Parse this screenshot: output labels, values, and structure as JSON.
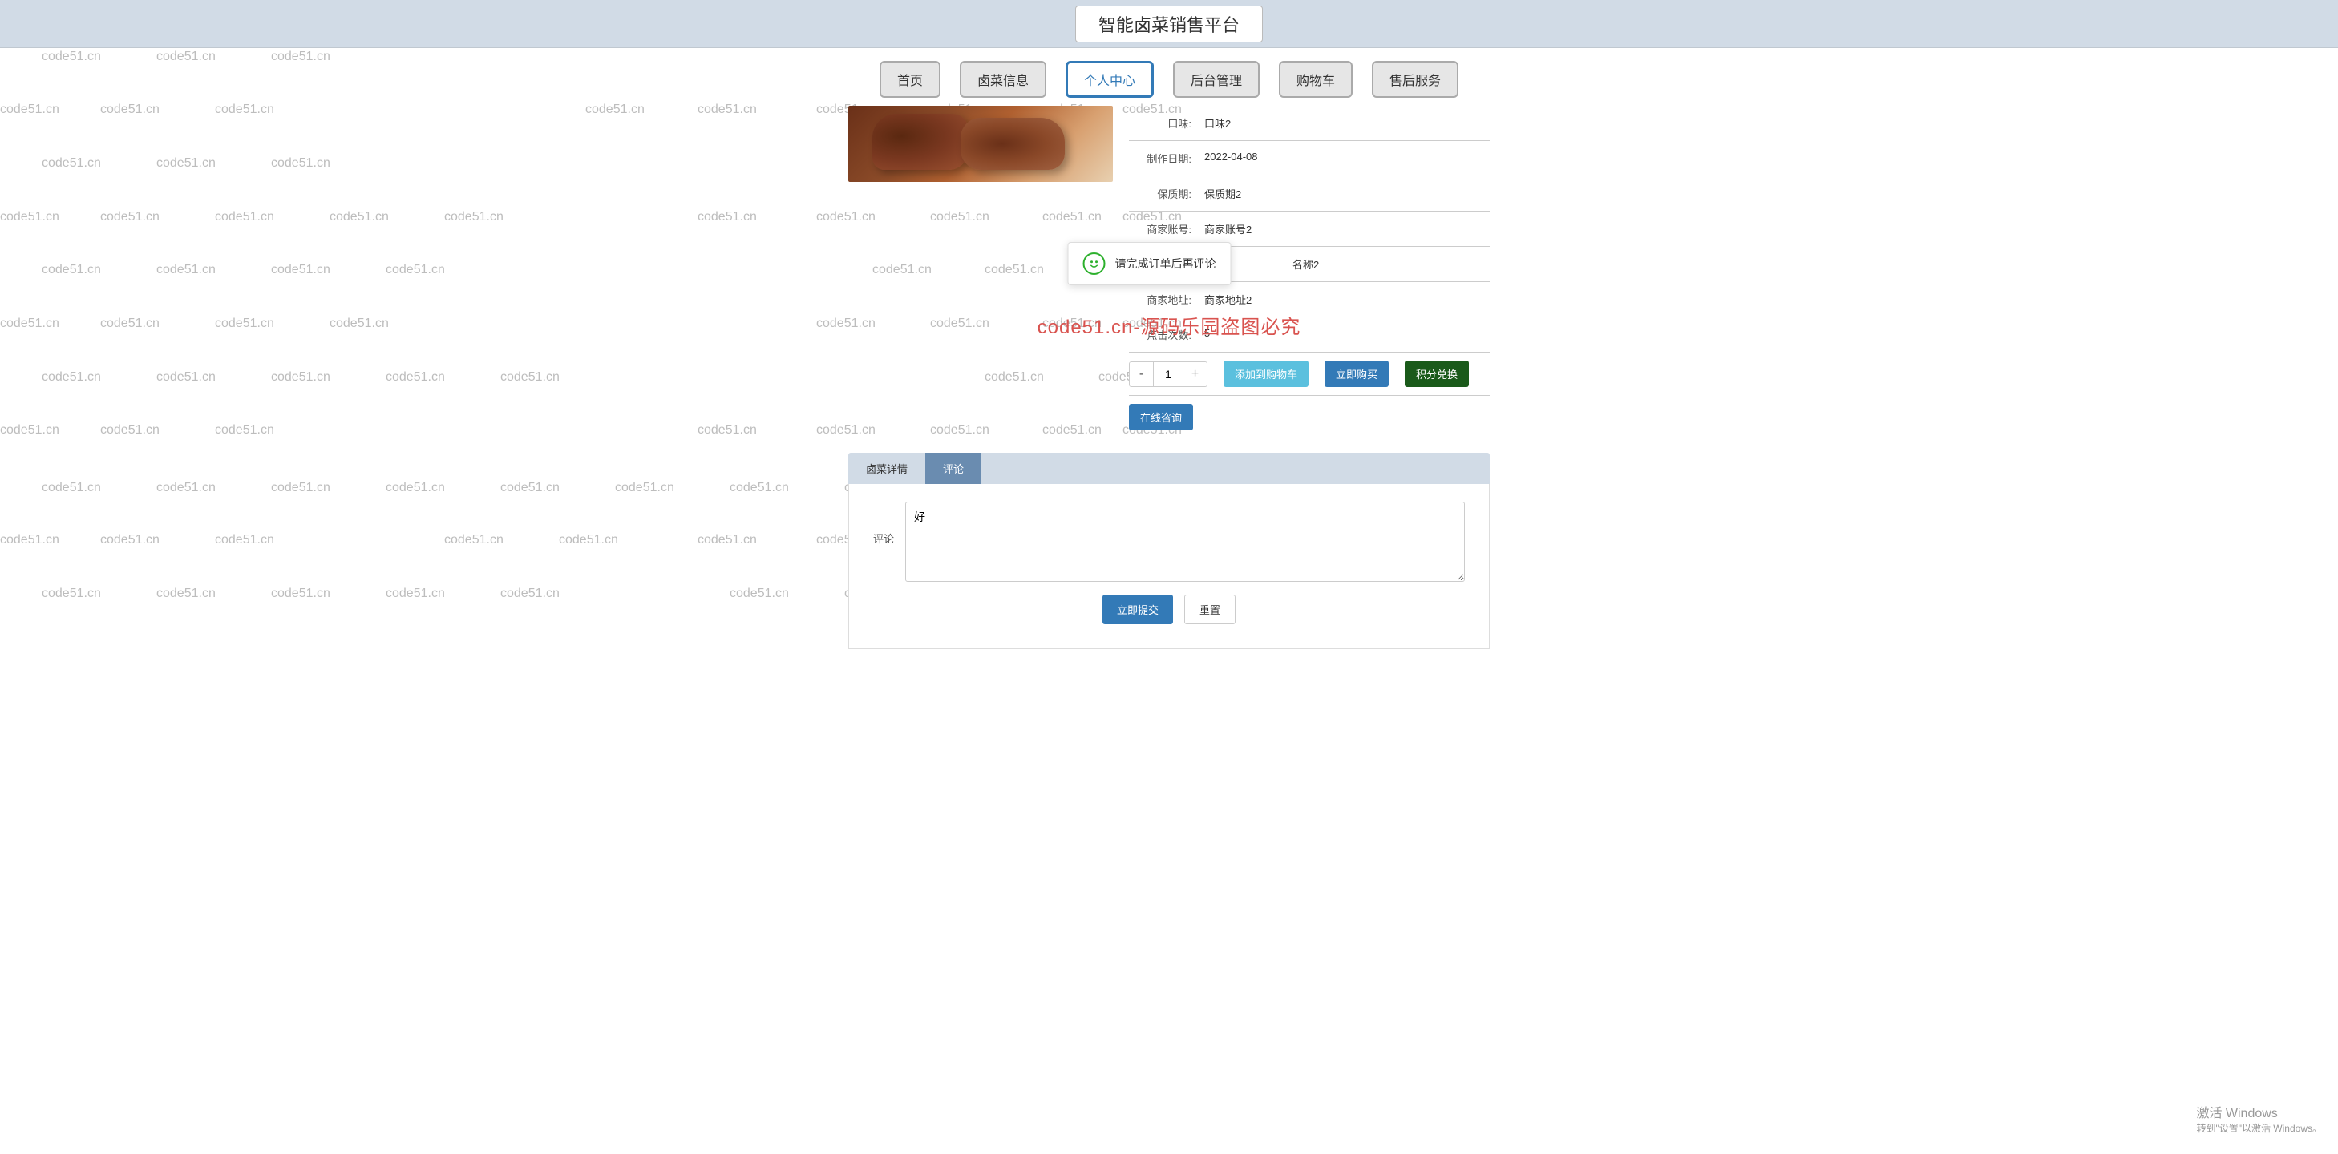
{
  "header": {
    "title": "智能卤菜销售平台"
  },
  "nav": {
    "items": [
      {
        "label": "首页"
      },
      {
        "label": "卤菜信息"
      },
      {
        "label": "个人中心"
      },
      {
        "label": "后台管理"
      },
      {
        "label": "购物车"
      },
      {
        "label": "售后服务"
      }
    ],
    "active_index": 2
  },
  "product": {
    "fields": [
      {
        "label": "口味:",
        "value": "口味2"
      },
      {
        "label": "制作日期:",
        "value": "2022-04-08"
      },
      {
        "label": "保质期:",
        "value": "保质期2"
      },
      {
        "label": "商家账号:",
        "value": "商家账号2"
      },
      {
        "label": "",
        "value": "名称2"
      },
      {
        "label": "商家地址:",
        "value": "商家地址2"
      },
      {
        "label": "点击次数:",
        "value": "5"
      }
    ],
    "qty": {
      "minus": "-",
      "value": "1",
      "plus": "+"
    },
    "actions": {
      "add_cart": "添加到购物车",
      "buy_now": "立即购买",
      "points": "积分兑换",
      "consult": "在线咨询"
    }
  },
  "toast": {
    "message": "请完成订单后再评论"
  },
  "tabs": {
    "items": [
      {
        "label": "卤菜详情"
      },
      {
        "label": "评论"
      }
    ],
    "active_index": 1
  },
  "comment_form": {
    "label": "评论",
    "textarea_value": "好",
    "submit": "立即提交",
    "reset": "重置"
  },
  "watermark": {
    "text": "code51.cn",
    "center": "code51.cn-源码乐园盗图必究"
  },
  "windows_activation": {
    "line1": "激活 Windows",
    "line2": "转到\"设置\"以激活 Windows。"
  }
}
